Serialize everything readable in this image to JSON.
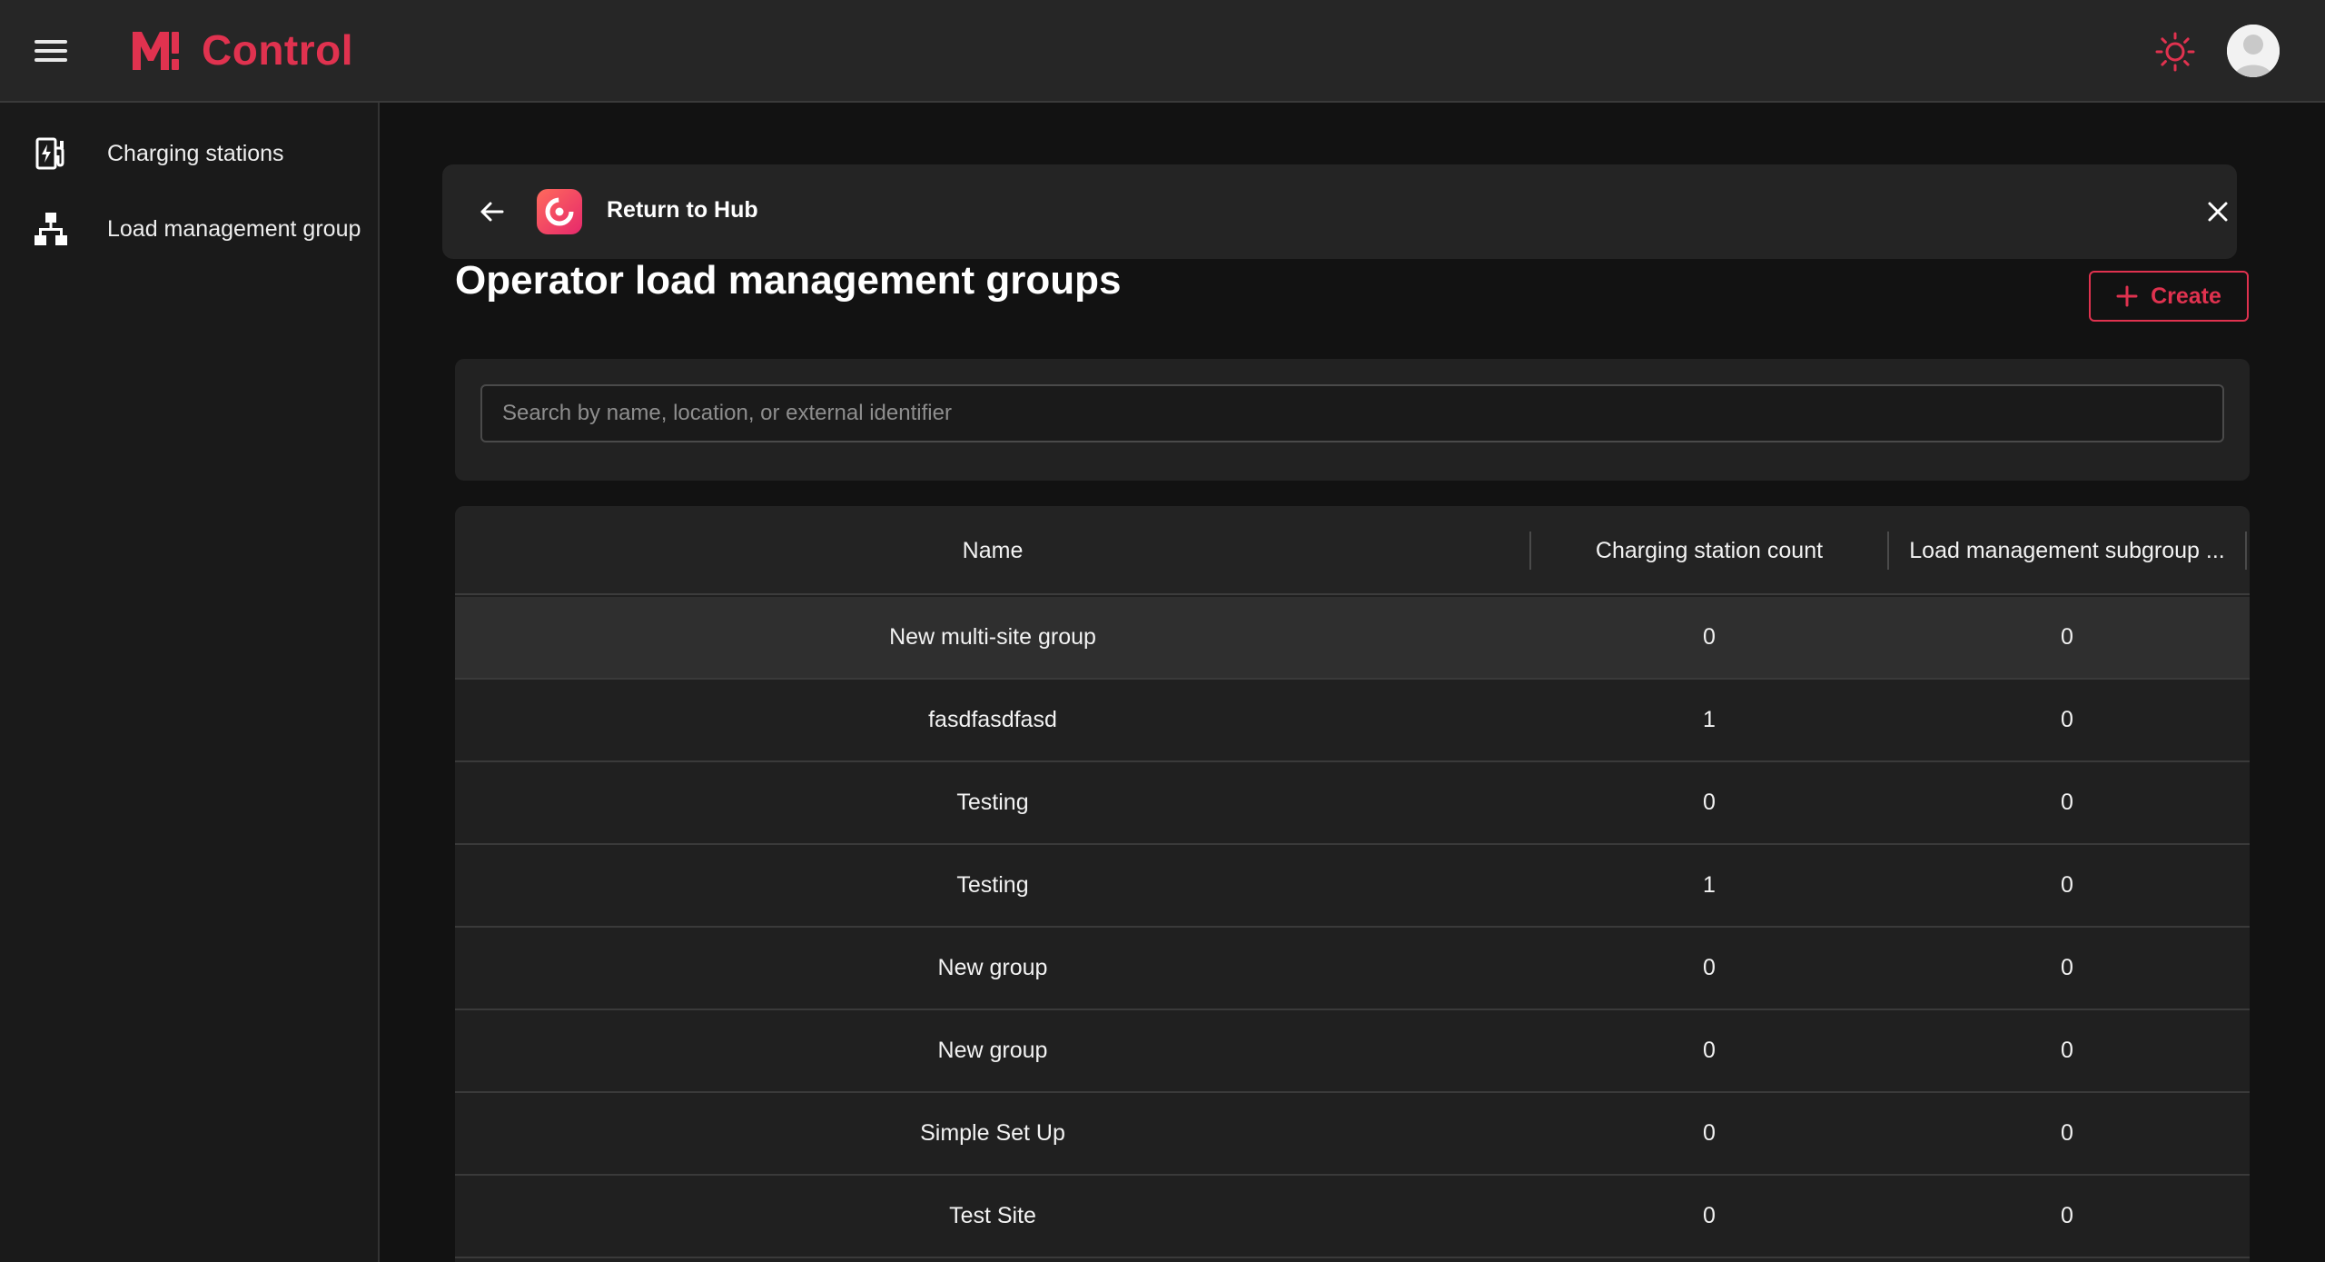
{
  "header": {
    "brand_name": "Control",
    "menu_icon": "hamburger-menu-icon",
    "theme_icon": "sun-icon",
    "avatar_icon": "user-avatar-icon",
    "colors": {
      "accent": "#e0324f",
      "topbar_bg": "#262626",
      "page_bg": "#121212"
    }
  },
  "sidebar": {
    "items": [
      {
        "label": "Charging stations",
        "icon": "charging-station-icon"
      },
      {
        "label": "Load management group",
        "icon": "hierarchy-icon"
      }
    ]
  },
  "hub_bar": {
    "label": "Return to Hub",
    "back_icon": "arrow-left-icon",
    "close_icon": "close-icon"
  },
  "page": {
    "title": "Operator load management groups",
    "create_label": "Create"
  },
  "search": {
    "placeholder": "Search by name, location, or external identifier",
    "value": ""
  },
  "table": {
    "columns": [
      "Name",
      "Charging station count",
      "Load management subgroup ..."
    ],
    "rows": [
      {
        "name": "New multi-site group",
        "count": "0",
        "subgroups": "0"
      },
      {
        "name": "fasdfasdfasd",
        "count": "1",
        "subgroups": "0"
      },
      {
        "name": "Testing",
        "count": "0",
        "subgroups": "0"
      },
      {
        "name": "Testing",
        "count": "1",
        "subgroups": "0"
      },
      {
        "name": "New group",
        "count": "0",
        "subgroups": "0"
      },
      {
        "name": "New group",
        "count": "0",
        "subgroups": "0"
      },
      {
        "name": "Simple Set Up",
        "count": "0",
        "subgroups": "0"
      },
      {
        "name": "Test Site",
        "count": "0",
        "subgroups": "0"
      }
    ]
  }
}
